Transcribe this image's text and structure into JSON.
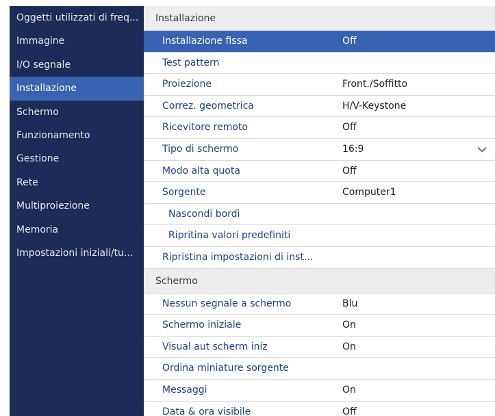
{
  "sidebar": {
    "items": [
      {
        "label": "Oggetti utilizzati di freq..."
      },
      {
        "label": "Immagine"
      },
      {
        "label": "I/O segnale"
      },
      {
        "label": "Installazione"
      },
      {
        "label": "Schermo"
      },
      {
        "label": "Funzionamento"
      },
      {
        "label": "Gestione"
      },
      {
        "label": "Rete"
      },
      {
        "label": "Multiproiezione"
      },
      {
        "label": "Memoria"
      },
      {
        "label": "Impostazioni iniziali/tu..."
      }
    ],
    "selected_label": "Installazione"
  },
  "installazione": {
    "header": "Installazione",
    "rows": [
      {
        "label": "Installazione fissa",
        "value": "Off"
      },
      {
        "label": "Test pattern",
        "value": ""
      },
      {
        "label": "Proiezione",
        "value": "Front./Soffitto"
      },
      {
        "label": "Correz. geometrica",
        "value": "H/V-Keystone"
      },
      {
        "label": "Ricevitore remoto",
        "value": "Off"
      },
      {
        "label": "Tipo di schermo",
        "value": "16:9"
      },
      {
        "label": "Modo alta quota",
        "value": "Off"
      },
      {
        "label": "Sorgente",
        "value": "Computer1"
      },
      {
        "label": "Nascondi bordi",
        "value": ""
      },
      {
        "label": "Ripritina valori predefiniti",
        "value": ""
      },
      {
        "label": "Ripristina impostazioni di inst...",
        "value": ""
      }
    ]
  },
  "schermo": {
    "header": "Schermo",
    "rows": [
      {
        "label": "Nessun segnale a schermo",
        "value": "Blu"
      },
      {
        "label": "Schermo iniziale",
        "value": "On"
      },
      {
        "label": "Visual aut scherm iniz",
        "value": "On"
      },
      {
        "label": "Ordina miniature sorgente",
        "value": ""
      },
      {
        "label": "Messaggi",
        "value": "On"
      },
      {
        "label": "Data & ora visibile",
        "value": "Off"
      }
    ]
  },
  "colors": {
    "sidebar_bg": "#1c2b57",
    "accent": "#3962b3",
    "label_text": "#1f3f8f"
  },
  "icons": {
    "dropdown": "chevron-down-icon"
  }
}
